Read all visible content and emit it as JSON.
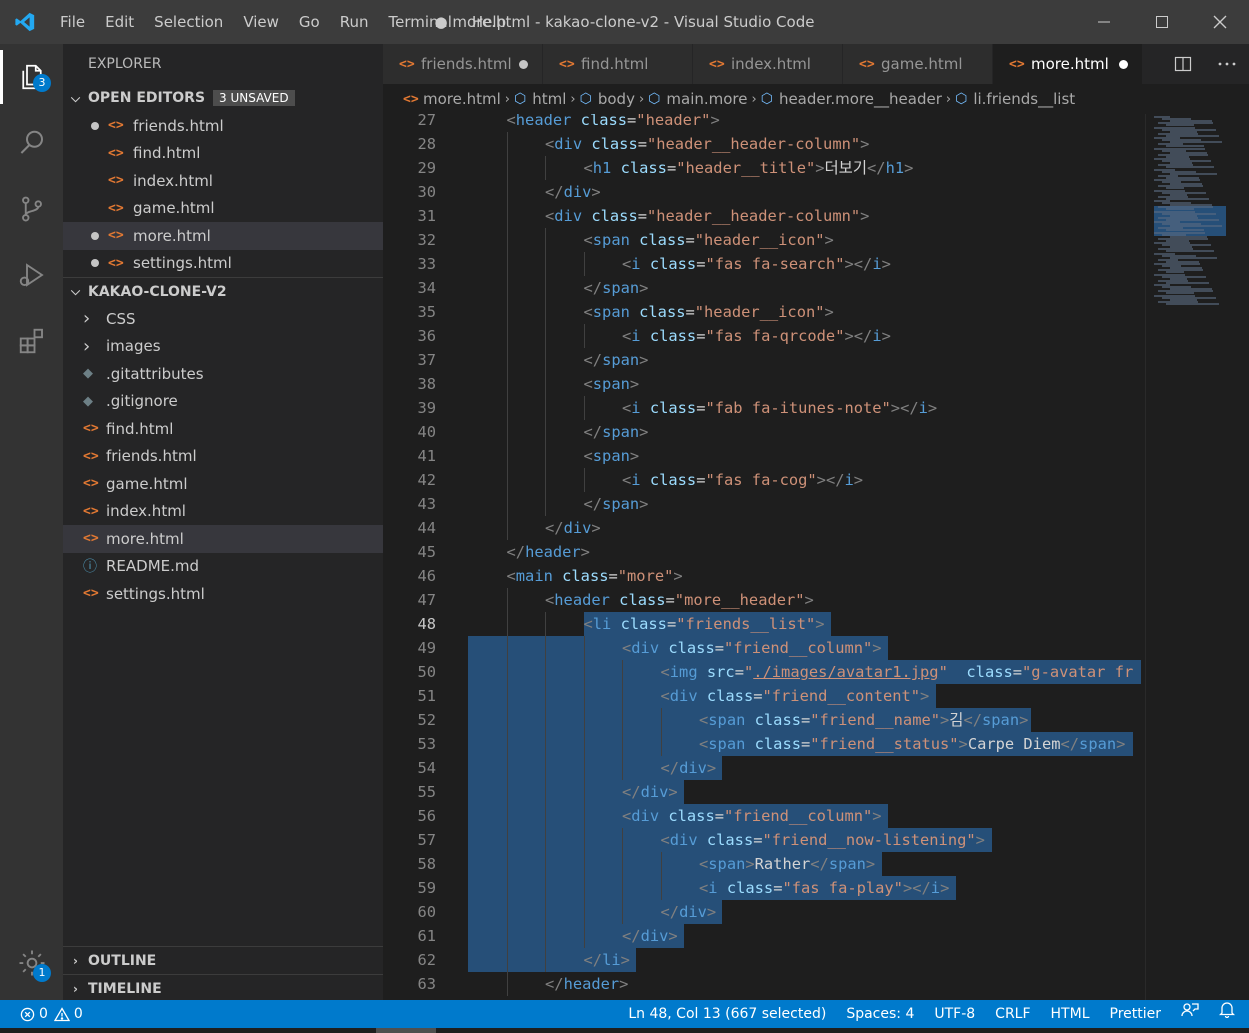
{
  "titlebar": {
    "menu": [
      "File",
      "Edit",
      "Selection",
      "View",
      "Go",
      "Run",
      "Terminal",
      "Help"
    ],
    "title": "● more.html - kakao-clone-v2 - Visual Studio Code"
  },
  "activity": {
    "explorer_badge": "3",
    "settings_badge": "1"
  },
  "sidebar": {
    "title": "EXPLORER",
    "open_editors_label": "OPEN EDITORS",
    "unsaved_badge": "3 UNSAVED",
    "open_editors": [
      {
        "name": "friends.html",
        "dirty": true
      },
      {
        "name": "find.html",
        "dirty": false
      },
      {
        "name": "index.html",
        "dirty": false
      },
      {
        "name": "game.html",
        "dirty": false
      },
      {
        "name": "more.html",
        "dirty": true
      },
      {
        "name": "settings.html",
        "dirty": true
      }
    ],
    "project_label": "KAKAO-CLONE-V2",
    "tree": [
      {
        "name": "CSS",
        "kind": "folder"
      },
      {
        "name": "images",
        "kind": "folder"
      },
      {
        "name": ".gitattributes",
        "kind": "git"
      },
      {
        "name": ".gitignore",
        "kind": "git"
      },
      {
        "name": "find.html",
        "kind": "html"
      },
      {
        "name": "friends.html",
        "kind": "html"
      },
      {
        "name": "game.html",
        "kind": "html"
      },
      {
        "name": "index.html",
        "kind": "html"
      },
      {
        "name": "more.html",
        "kind": "html"
      },
      {
        "name": "README.md",
        "kind": "info"
      },
      {
        "name": "settings.html",
        "kind": "html"
      }
    ],
    "outline_label": "OUTLINE",
    "timeline_label": "TIMELINE"
  },
  "tabs": [
    {
      "name": "friends.html",
      "dirty": true,
      "active": false
    },
    {
      "name": "find.html",
      "dirty": false,
      "active": false
    },
    {
      "name": "index.html",
      "dirty": false,
      "active": false
    },
    {
      "name": "game.html",
      "dirty": false,
      "active": false
    },
    {
      "name": "more.html",
      "dirty": true,
      "active": true
    }
  ],
  "breadcrumb": [
    "more.html",
    "html",
    "body",
    "main.more",
    "header.more__header",
    "li.friends__list"
  ],
  "editor": {
    "first_line": 26,
    "partial_top": "</div>",
    "lines": [
      {
        "n": 27,
        "i": 1,
        "t": "<header class=\"header\">"
      },
      {
        "n": 28,
        "i": 2,
        "t": "<div class=\"header__header-column\">"
      },
      {
        "n": 29,
        "i": 3,
        "t": "<h1 class=\"header__title\">더보기</h1>"
      },
      {
        "n": 30,
        "i": 2,
        "t": "</div>"
      },
      {
        "n": 31,
        "i": 2,
        "t": "<div class=\"header__header-column\">"
      },
      {
        "n": 32,
        "i": 3,
        "t": "<span class=\"header__icon\">"
      },
      {
        "n": 33,
        "i": 4,
        "t": "<i class=\"fas fa-search\"></i>"
      },
      {
        "n": 34,
        "i": 3,
        "t": "</span>"
      },
      {
        "n": 35,
        "i": 3,
        "t": "<span class=\"header__icon\">"
      },
      {
        "n": 36,
        "i": 4,
        "t": "<i class=\"fas fa-qrcode\"></i>"
      },
      {
        "n": 37,
        "i": 3,
        "t": "</span>"
      },
      {
        "n": 38,
        "i": 3,
        "t": "<span>"
      },
      {
        "n": 39,
        "i": 4,
        "t": "<i class=\"fab fa-itunes-note\"></i>"
      },
      {
        "n": 40,
        "i": 3,
        "t": "</span>"
      },
      {
        "n": 41,
        "i": 3,
        "t": "<span>"
      },
      {
        "n": 42,
        "i": 4,
        "t": "<i class=\"fas fa-cog\"></i>"
      },
      {
        "n": 43,
        "i": 3,
        "t": "</span>"
      },
      {
        "n": 44,
        "i": 2,
        "t": "</div>"
      },
      {
        "n": 45,
        "i": 1,
        "t": "</header>"
      },
      {
        "n": 46,
        "i": 1,
        "t": "<main class=\"more\">"
      },
      {
        "n": 47,
        "i": 2,
        "t": "<header class=\"more__header\">"
      },
      {
        "n": 48,
        "i": 3,
        "t": "<li class=\"friends__list\">",
        "sel": true,
        "selStart": true
      },
      {
        "n": 49,
        "i": 4,
        "t": "<div class=\"friend__column\">",
        "sel": true
      },
      {
        "n": 50,
        "i": 5,
        "t": "<img src=\"./images/avatar1.jpg\"  class=\"g-avatar fr",
        "sel": true
      },
      {
        "n": 51,
        "i": 5,
        "t": "<div class=\"friend__content\">",
        "sel": true
      },
      {
        "n": 52,
        "i": 6,
        "t": "<span class=\"friend__name\">김</span>",
        "sel": true
      },
      {
        "n": 53,
        "i": 6,
        "t": "<span class=\"friend__status\">Carpe Diem</span>",
        "sel": true
      },
      {
        "n": 54,
        "i": 5,
        "t": "</div>",
        "sel": true
      },
      {
        "n": 55,
        "i": 4,
        "t": "</div>",
        "sel": true
      },
      {
        "n": 56,
        "i": 4,
        "t": "<div class=\"friend__column\">",
        "sel": true
      },
      {
        "n": 57,
        "i": 5,
        "t": "<div class=\"friend__now-listening\">",
        "sel": true
      },
      {
        "n": 58,
        "i": 6,
        "t": "<span>Rather</span>",
        "sel": true
      },
      {
        "n": 59,
        "i": 6,
        "t": "<i class=\"fas fa-play\"></i>",
        "sel": true
      },
      {
        "n": 60,
        "i": 5,
        "t": "</div>",
        "sel": true
      },
      {
        "n": 61,
        "i": 4,
        "t": "</div>",
        "sel": true
      },
      {
        "n": 62,
        "i": 3,
        "t": "</li>",
        "sel": true
      },
      {
        "n": 63,
        "i": 2,
        "t": "</header>"
      }
    ]
  },
  "status": {
    "errors": "0",
    "warnings": "0",
    "position": "Ln 48, Col 13 (667 selected)",
    "spaces": "Spaces: 4",
    "encoding": "UTF-8",
    "eol": "CRLF",
    "language": "HTML",
    "formatter": "Prettier"
  },
  "colors": {
    "accent": "#007acc",
    "selection": "#264f78",
    "tag": "#569cd6",
    "attr": "#9cdcfe",
    "string": "#ce9178"
  }
}
